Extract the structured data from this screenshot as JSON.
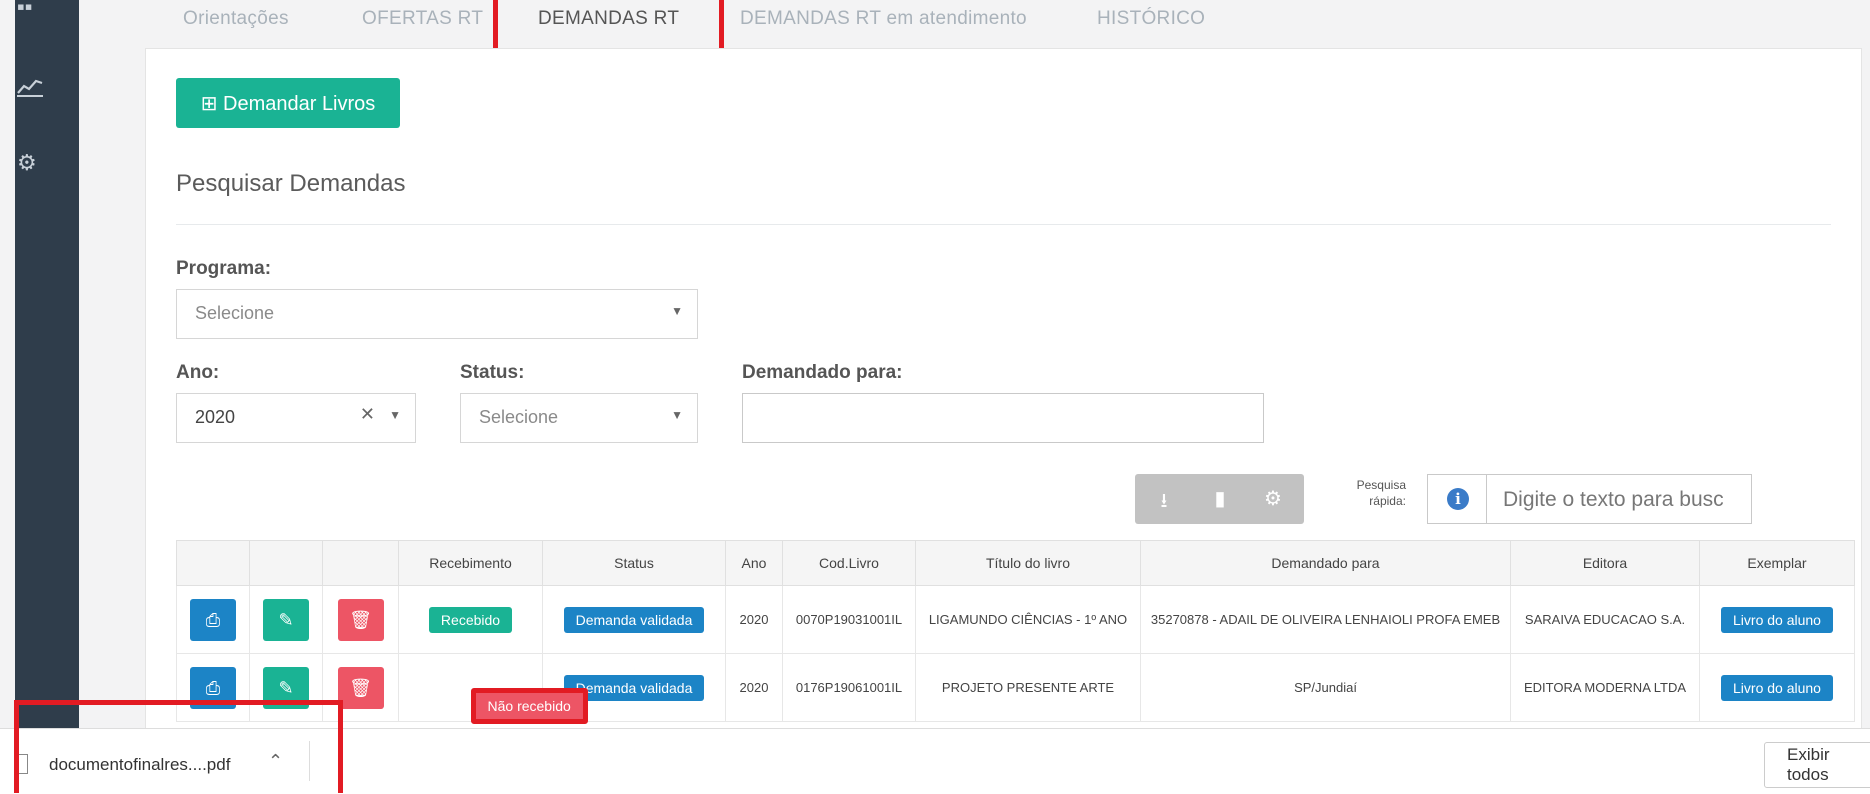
{
  "tabs": [
    "Orientações",
    "OFERTAS RT",
    "DEMANDAS RT",
    "DEMANDAS RT em atendimento",
    "HISTÓRICO"
  ],
  "demandar_button": "⊞ Demandar Livros",
  "section_title": "Pesquisar Demandas",
  "filters": {
    "programa_label": "Programa:",
    "programa_value": "Selecione",
    "ano_label": "Ano:",
    "ano_value": "2020",
    "status_label": "Status:",
    "status_value": "Selecione",
    "demandado_label": "Demandado para:",
    "demandado_value": ""
  },
  "quick_search": {
    "label": "Pesquisa rápida:",
    "placeholder": "Digite o texto para busc"
  },
  "table": {
    "headers": [
      "",
      "",
      "",
      "Recebimento",
      "Status",
      "Ano",
      "Cod.Livro",
      "Título do livro",
      "Demandado para",
      "Editora",
      "Exemplar"
    ],
    "rows": [
      {
        "recebimento": "Recebido",
        "recebimento_color": "#1ab394",
        "status": "Demanda validada",
        "ano": "2020",
        "cod": "0070P19031001IL",
        "titulo": "LIGAMUNDO CIÊNCIAS - 1º ANO",
        "demandado": "35270878 - ADAIL DE OLIVEIRA LENHAIOLI PROFA EMEB",
        "editora": "SARAIVA EDUCACAO S.A.",
        "exemplar": "Livro do aluno"
      },
      {
        "recebimento": "Não recebido",
        "recebimento_color": "#ed5565",
        "status": "Demanda validada",
        "ano": "2020",
        "cod": "0176P19061001IL",
        "titulo": "PROJETO PRESENTE ARTE",
        "demandado": "SP/Jundiaí",
        "editora": "EDITORA MODERNA LTDA",
        "exemplar": "Livro do aluno"
      }
    ]
  },
  "download": {
    "filename": "documentofinalres....pdf",
    "show_all": "Exibir todos"
  },
  "colors": {
    "green": "#1ab394",
    "blue": "#1c84c6",
    "red": "#ed5565",
    "sidebar": "#2f3d4b",
    "highlight": "#e21b23"
  }
}
